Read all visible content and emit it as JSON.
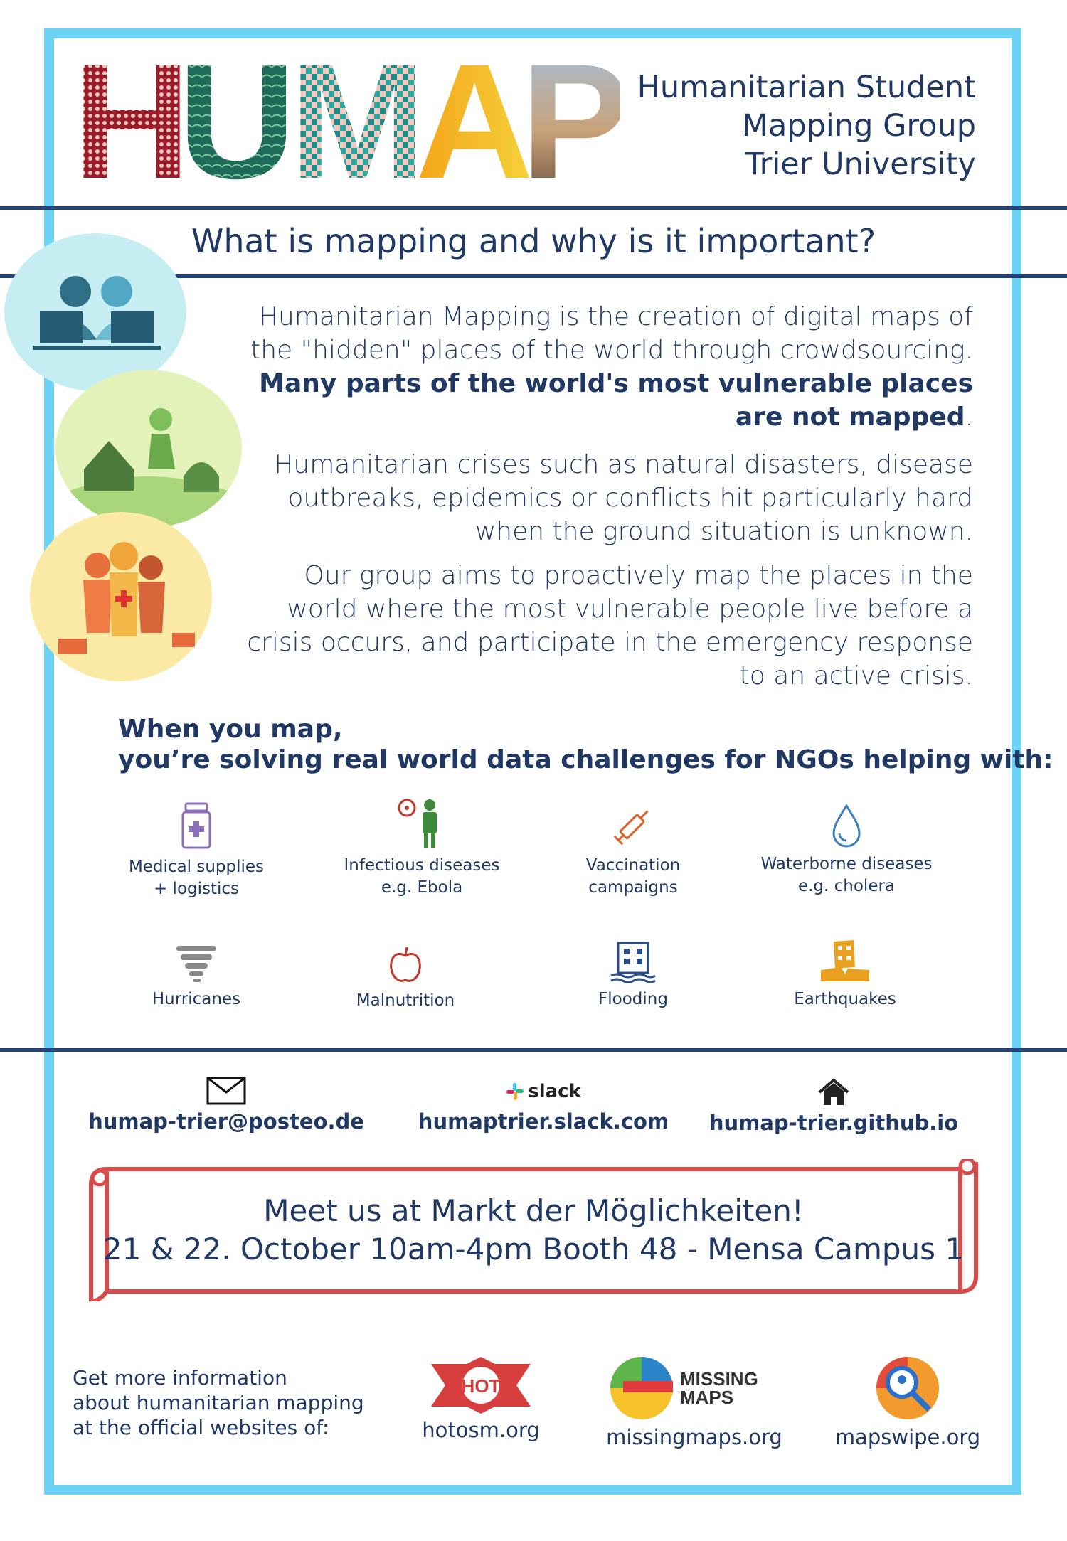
{
  "header": {
    "logo_letters": [
      "H",
      "U",
      "M",
      "A",
      "P"
    ],
    "org_lines": [
      "Humanitarian Student",
      "Mapping Group",
      "Trier University"
    ]
  },
  "question": "What is mapping and why is it important?",
  "paragraphs": {
    "p1_lines": [
      "Humanitarian Mapping is the creation of digital maps of",
      "the \"hidden\" places of the world through crowdsourcing."
    ],
    "p1_bold_lines": [
      "Many parts of the world's most vulnerable places",
      "are not mapped"
    ],
    "p1_period": ".",
    "p2_lines": [
      "Humanitarian crises such as natural disasters, disease",
      "outbreaks, epidemics or conflicts hit particularly hard",
      "when the ground situation is unknown."
    ],
    "p3_lines": [
      "Our group aims to proactively map the places in the",
      "world where the most vulnerable people live before a",
      "crisis occurs, and participate in the emergency response",
      "to an active crisis."
    ]
  },
  "when": {
    "line1": "When you map,",
    "line2": "you’re solving real world data challenges for NGOs helping with:"
  },
  "challenges": [
    {
      "icon": "medicine-bottle-icon",
      "line1": "Medical supplies",
      "line2": "+ logistics"
    },
    {
      "icon": "biohazard-suit-icon",
      "line1": "Infectious diseases",
      "line2": "e.g. Ebola"
    },
    {
      "icon": "syringe-icon",
      "line1": "Vaccination",
      "line2": "campaigns"
    },
    {
      "icon": "water-drop-icon",
      "line1": "Waterborne diseases",
      "line2": "e.g. cholera"
    },
    {
      "icon": "tornado-icon",
      "line1": "Hurricanes",
      "line2": ""
    },
    {
      "icon": "apple-icon",
      "line1": "Malnutrition",
      "line2": ""
    },
    {
      "icon": "flooded-building-icon",
      "line1": "Flooding",
      "line2": ""
    },
    {
      "icon": "collapsed-building-icon",
      "line1": "Earthquakes",
      "line2": ""
    }
  ],
  "contacts": {
    "email": "humap-trier@posteo.de",
    "slack_word": "slack",
    "slack": "humaptrier.slack.com",
    "web": "humap-trier.github.io"
  },
  "banner": {
    "line1": "Meet us at Markt der Möglichkeiten!",
    "line2": "21 & 22. October 10am-4pm Booth 48 - Mensa Campus 1"
  },
  "footer": {
    "more_lines": [
      "Get more information",
      "about humanitarian mapping",
      "at the official websites of:"
    ],
    "hot_logo_text": "HOT",
    "missing_maps_logo_lines": [
      "MISSING",
      "MAPS"
    ],
    "partners": [
      "hotosm.org",
      "missingmaps.org",
      "mapswipe.org"
    ]
  },
  "colors": {
    "frame": "#6dd3f5",
    "navy": "#1f3864",
    "banner_red": "#d94b4b"
  }
}
